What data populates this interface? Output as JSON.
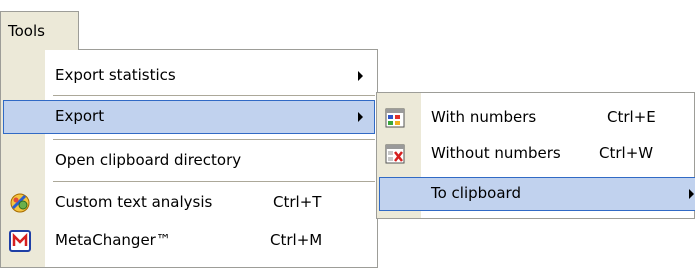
{
  "menubar": {
    "tools_label": "Tools"
  },
  "main_menu": {
    "export_statistics": "Export statistics",
    "export": "Export",
    "open_clipboard_directory": "Open clipboard directory",
    "custom_text_analysis": "Custom text analysis",
    "custom_text_analysis_shortcut": "Ctrl+T",
    "metachanger": "MetaChanger™",
    "metachanger_shortcut": "Ctrl+M"
  },
  "export_submenu": {
    "with_numbers": "With numbers",
    "with_numbers_shortcut": "Ctrl+E",
    "without_numbers": "Without numbers",
    "without_numbers_shortcut": "Ctrl+W",
    "to_clipboard": "To clipboard"
  },
  "colors": {
    "menu_bg": "#ffffff",
    "gutter_bg": "#ece9d8",
    "highlight_bg": "#c1d2ee",
    "highlight_border": "#316ac5",
    "border": "#9d9d98"
  }
}
